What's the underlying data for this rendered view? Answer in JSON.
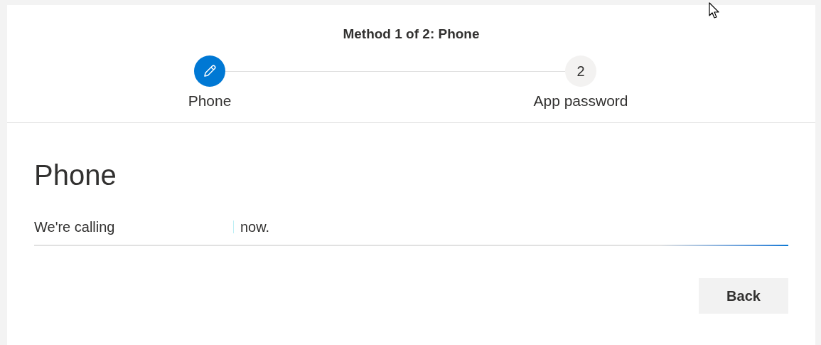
{
  "header": {
    "title": "Method 1 of 2: Phone"
  },
  "steps": [
    {
      "label": "Phone",
      "selected": true
    },
    {
      "label": "App password",
      "number": "2",
      "selected": false
    }
  ],
  "section": {
    "heading": "Phone",
    "message_start": "We're calling",
    "message_end": "now."
  },
  "progress": {
    "active": true
  },
  "buttons": [
    {
      "label": "Back"
    }
  ]
}
